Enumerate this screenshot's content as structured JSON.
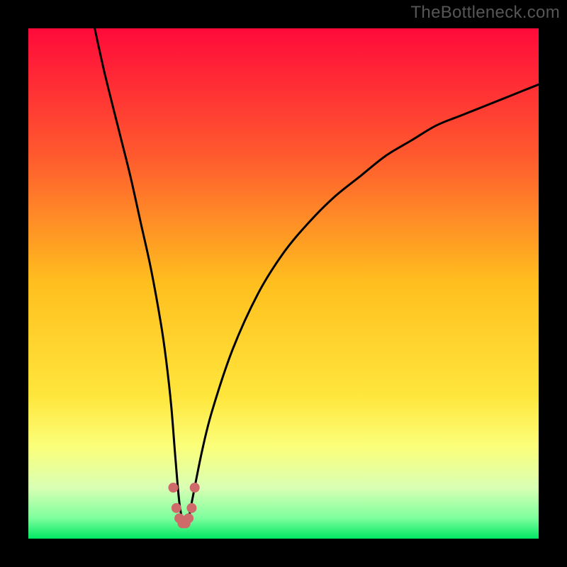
{
  "watermark": "TheBottleneck.com",
  "chart_data": {
    "type": "line",
    "title": "",
    "xlabel": "",
    "ylabel": "",
    "xlim": [
      0,
      100
    ],
    "ylim": [
      0,
      100
    ],
    "series": [
      {
        "name": "curve",
        "x": [
          13,
          15,
          18,
          20,
          22,
          24,
          26,
          27,
          28,
          28.8,
          29.6,
          30.4,
          31.2,
          32,
          34,
          36,
          40,
          45,
          50,
          55,
          60,
          65,
          70,
          75,
          80,
          85,
          90,
          95,
          100
        ],
        "y": [
          100,
          91,
          79,
          71,
          62,
          53,
          42,
          35,
          26,
          16,
          7,
          3,
          3,
          7,
          17,
          25,
          37,
          48,
          56,
          62,
          67,
          71,
          75,
          78,
          81,
          83,
          85,
          87,
          89
        ]
      }
    ],
    "markers": {
      "name": "bottom-dots",
      "x": [
        28.4,
        29,
        29.6,
        30.2,
        30.8,
        31.4,
        32,
        32.6
      ],
      "y": [
        10,
        6,
        4,
        3,
        3,
        4,
        6,
        10
      ],
      "color": "#cf6a6a",
      "radius_px": 7
    },
    "background_gradient": {
      "stops": [
        {
          "pos": 0.0,
          "color": "#ff0a3a"
        },
        {
          "pos": 0.25,
          "color": "#ff5a2e"
        },
        {
          "pos": 0.5,
          "color": "#ffbf1e"
        },
        {
          "pos": 0.72,
          "color": "#ffe63c"
        },
        {
          "pos": 0.82,
          "color": "#fbff7a"
        },
        {
          "pos": 0.9,
          "color": "#d9ffb4"
        },
        {
          "pos": 0.96,
          "color": "#7dff9d"
        },
        {
          "pos": 1.0,
          "color": "#00e763"
        }
      ]
    }
  }
}
